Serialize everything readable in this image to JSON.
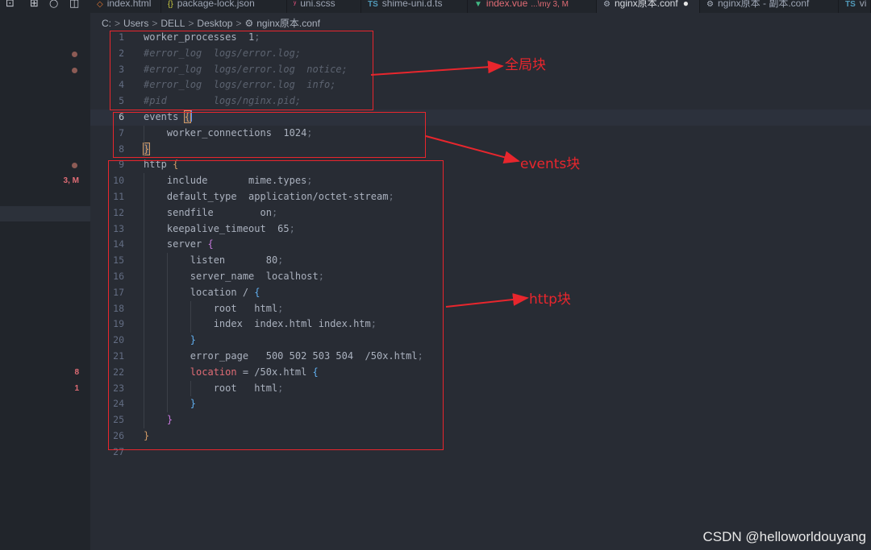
{
  "tabs": [
    {
      "label": "index.html",
      "icon": "html",
      "active": false
    },
    {
      "label": "package-lock.json",
      "icon": "json",
      "active": false
    },
    {
      "label": "uni.scss",
      "icon": "scss",
      "active": false
    },
    {
      "label": "shime-uni.d.ts",
      "icon": "ts",
      "active": false
    },
    {
      "label": "index.vue",
      "extra": "...\\my 3, M",
      "icon": "vue",
      "active": false
    },
    {
      "label": "nginx原本.conf",
      "icon": "gear",
      "active": true,
      "modified": true
    },
    {
      "label": "nginx原本 - 副本.conf",
      "icon": "gear",
      "active": false
    },
    {
      "label": "vi",
      "icon": "ts",
      "active": false
    }
  ],
  "breadcrumb": [
    "C:",
    "Users",
    "DELL",
    "Desktop",
    "nginx原本.conf"
  ],
  "sidebar": {
    "badges": [
      {
        "line": 2,
        "text": ""
      },
      {
        "line": 3,
        "text": ""
      },
      {
        "line": 9,
        "text": ""
      },
      {
        "line": 10,
        "text": "3, M"
      },
      {
        "line": 22,
        "text": "8"
      },
      {
        "line": 23,
        "text": "1"
      }
    ]
  },
  "editor": {
    "current_line": 6,
    "lines": [
      {
        "n": "1",
        "html": "worker_processes  1<span class=\"c-dim\">;</span>"
      },
      {
        "n": "2",
        "html": "<span class=\"c-com\">#error_log  logs/error.log;</span>"
      },
      {
        "n": "3",
        "html": "<span class=\"c-com\">#error_log  logs/error.log  notice;</span>"
      },
      {
        "n": "4",
        "html": "<span class=\"c-com\">#error_log  logs/error.log  info;</span>"
      },
      {
        "n": "5",
        "html": "<span class=\"c-com\">#pid        logs/nginx.pid;</span>"
      },
      {
        "n": "6",
        "html": "events <span class=\"c-br1 cursorbr\">{</span><span class=\"caret\"></span>"
      },
      {
        "n": "7",
        "html": "    worker_connections  1024<span class=\"c-dim\">;</span>"
      },
      {
        "n": "8",
        "html": "<span class=\"c-br1 cursorbr\">}</span>"
      },
      {
        "n": "9",
        "html": "http <span class=\"c-br1\">{</span>"
      },
      {
        "n": "10",
        "html": "    include       mime.types<span class=\"c-dim\">;</span>"
      },
      {
        "n": "11",
        "html": "    default_type  application/octet-stream<span class=\"c-dim\">;</span>"
      },
      {
        "n": "12",
        "html": "    sendfile        on<span class=\"c-dim\">;</span>"
      },
      {
        "n": "13",
        "html": "    keepalive_timeout  65<span class=\"c-dim\">;</span>"
      },
      {
        "n": "14",
        "html": "    server <span class=\"c-br2\">{</span>"
      },
      {
        "n": "15",
        "html": "        listen       80<span class=\"c-dim\">;</span>"
      },
      {
        "n": "16",
        "html": "        server_name  localhost<span class=\"c-dim\">;</span>"
      },
      {
        "n": "17",
        "html": "        location / <span class=\"c-br3\">{</span>"
      },
      {
        "n": "18",
        "html": "            root   html<span class=\"c-dim\">;</span>"
      },
      {
        "n": "19",
        "html": "            index  index.html index.htm<span class=\"c-dim\">;</span>"
      },
      {
        "n": "20",
        "html": "        <span class=\"c-br3\">}</span>"
      },
      {
        "n": "21",
        "html": "        error_page   500 502 503 504  /50x.html<span class=\"c-dim\">;</span>"
      },
      {
        "n": "22",
        "html": "        <span class=\"c-red\">location</span> = /50x.html <span class=\"c-br3\">{</span>"
      },
      {
        "n": "23",
        "html": "            root   html<span class=\"c-dim\">;</span>"
      },
      {
        "n": "24",
        "html": "        <span class=\"c-br3\">}</span>"
      },
      {
        "n": "25",
        "html": "    <span class=\"c-br2\">}</span>"
      },
      {
        "n": "26",
        "html": "<span class=\"c-br1\">}</span>"
      },
      {
        "n": "27",
        "html": ""
      }
    ]
  },
  "annotations": {
    "global_label": "全局块",
    "events_label": "events块",
    "http_label": "http块",
    "color": "#e8262d"
  },
  "watermark": "CSDN @helloworldouyang"
}
